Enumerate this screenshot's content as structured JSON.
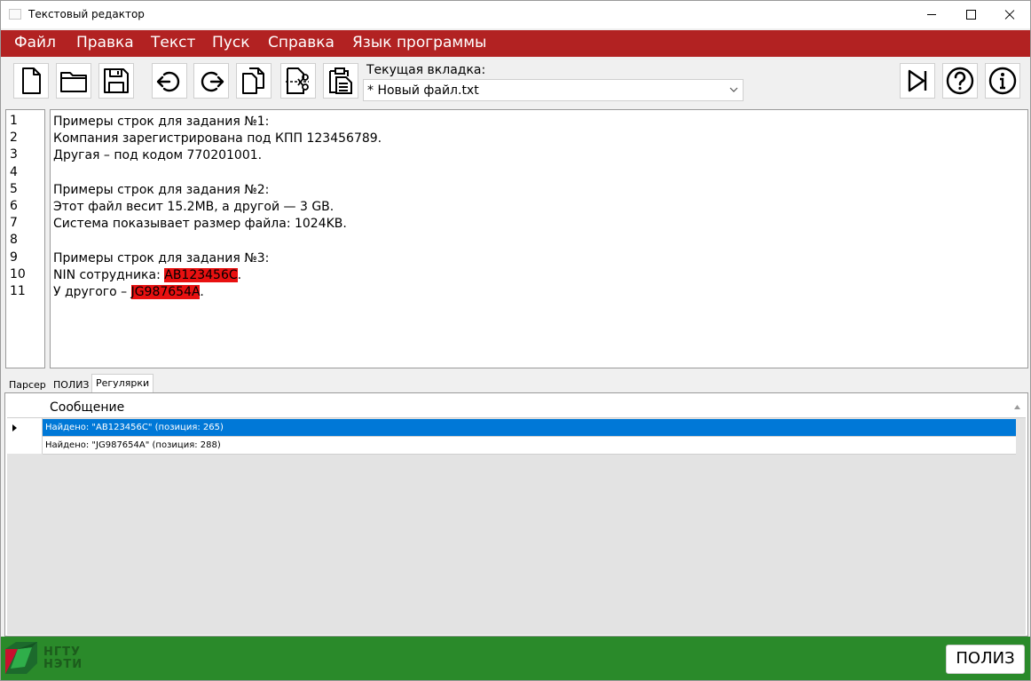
{
  "window": {
    "title": "Текстовый редактор"
  },
  "menu": [
    "Файл",
    "Правка",
    "Текст",
    "Пуск",
    "Справка",
    "Язык программы"
  ],
  "toolbar": {
    "icons": [
      "new-file-icon",
      "open-folder-icon",
      "save-icon",
      "undo-icon",
      "redo-icon",
      "copy-icon",
      "cut-icon",
      "paste-icon",
      "run-icon",
      "help-icon",
      "info-icon"
    ],
    "current_tab_label": "Текущая вкладка:",
    "current_tab_value": "* Новый файл.txt"
  },
  "editor": {
    "line_numbers": [
      "1",
      "2",
      "3",
      "4",
      "5",
      "6",
      "7",
      "8",
      "9",
      "10",
      "11"
    ],
    "lines": [
      {
        "text": "Примеры строк для задания №1:"
      },
      {
        "text": "Компания зарегистрирована под КПП 123456789."
      },
      {
        "text": "Другая – под кодом 770201001."
      },
      {
        "text": ""
      },
      {
        "text": "Примеры строк для задания №2:"
      },
      {
        "text": "Этот файл весит 15.2MB, а другой — 3 GB."
      },
      {
        "text": "Система показывает размер файла: 1024KB."
      },
      {
        "text": ""
      },
      {
        "text": "Примеры строк для задания №3:"
      },
      {
        "before": "NIN сотрудника: ",
        "match": "AB123456C",
        "after": "."
      },
      {
        "before": "У другого – ",
        "match": "JG987654A",
        "after": "."
      }
    ],
    "highlight_color": "#e81010"
  },
  "bottom_tabs": [
    "Парсер",
    "ПОЛИЗ",
    "Регулярки"
  ],
  "active_bottom_tab": "Регулярки",
  "results": {
    "column_header": "Сообщение",
    "rows": [
      "Найдено: \"AB123456C\" (позиция: 265)",
      "Найдено: \"JG987654A\" (позиция: 288)"
    ],
    "selected_row": 0
  },
  "footer": {
    "logo_line1": "НГТУ",
    "logo_line2": "НЭТИ",
    "button_label": "ПОЛИЗ"
  },
  "colors": {
    "menu_bar": "#b22222",
    "footer": "#2a8a2a",
    "selection": "#0078d7"
  }
}
